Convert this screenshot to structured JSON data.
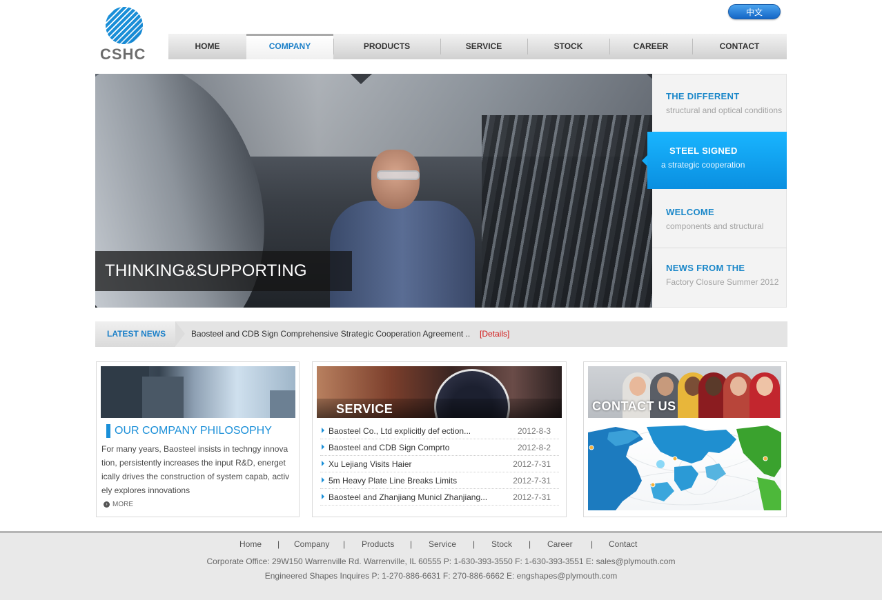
{
  "header": {
    "logo_text": "CSHC",
    "lang_button": "中文",
    "nav": [
      "HOME",
      "COMPANY",
      "PRODUCTS",
      "SERVICE",
      "STOCK",
      "CAREER",
      "CONTACT"
    ],
    "active_nav": "COMPANY"
  },
  "banner": {
    "caption": "THINKING&SUPPORTING",
    "side_items": [
      {
        "title": "THE DIFFERENT",
        "subtitle": "structural and optical conditions"
      },
      {
        "title": "STEEL SIGNED",
        "subtitle": "a strategic cooperation"
      },
      {
        "title": "WELCOME",
        "subtitle": "components and structural"
      },
      {
        "title": "NEWS FROM THE",
        "subtitle": "Factory Closure Summer 2012"
      }
    ],
    "active_side": 1
  },
  "latest_news": {
    "label": "LATEST NEWS",
    "text": "Baosteel and CDB Sign Comprehensive Strategic Cooperation Agreement ..",
    "link": "[Details]"
  },
  "philosophy": {
    "title": "OUR COMPANY PHILOSOPHY",
    "lines": [
      "For many years, Baosteel insists in techngy innova",
      "tion, persistently increases the input R&D, energet",
      "ically drives the construction of system capab, activ",
      "ely explores innovations"
    ],
    "more": "MORE"
  },
  "service": {
    "title": "SERVICE",
    "items": [
      {
        "title": "Baosteel Co., Ltd explicitly def ection...",
        "date": "2012-8-3"
      },
      {
        "title": "Baosteel and CDB Sign Comprto",
        "date": "2012-8-2"
      },
      {
        "title": "Xu Lejiang Visits Haier",
        "date": "2012-7-31"
      },
      {
        "title": "5m Heavy Plate Line Breaks Limits",
        "date": "2012-7-31"
      },
      {
        "title": "Baosteel and Zhanjiang Municl Zhanjiang...",
        "date": "2012-7-31"
      }
    ]
  },
  "contact": {
    "title": "CONTACT US"
  },
  "footer": {
    "links": [
      "Home",
      "Company",
      "Products",
      "Service",
      "Stock",
      "Career",
      "Contact"
    ],
    "line1": "Corporate Office: 29W150 Warrenville Rd. Warrenville, IL 60555 P: 1-630-393-3550 F: 1-630-393-3551 E: sales@plymouth.com",
    "line2": "Engineered Shapes Inquires P: 1-270-886-6631 F: 270-886-6662 E: engshapes@plymouth.com"
  },
  "colors": {
    "brand_blue": "#1a8fd8",
    "active_blue": "#0a8fe0",
    "details_red": "#d11414"
  }
}
